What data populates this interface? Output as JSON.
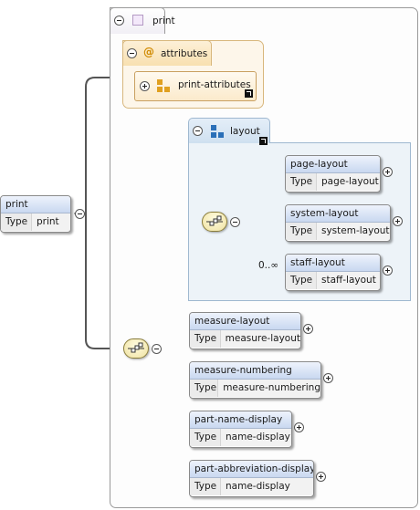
{
  "root": {
    "name": "print",
    "type_key": "Type",
    "type_value": "print"
  },
  "complex_type": {
    "label": "print"
  },
  "attributes": {
    "label": "attributes",
    "group_ref": "print-attributes"
  },
  "layout_group": {
    "label": "layout",
    "elements": [
      {
        "name": "page-layout",
        "type_key": "Type",
        "type_value": "page-layout"
      },
      {
        "name": "system-layout",
        "type_key": "Type",
        "type_value": "system-layout"
      },
      {
        "name": "staff-layout",
        "type_key": "Type",
        "type_value": "staff-layout",
        "multiplicity": "0..∞"
      }
    ]
  },
  "sequence_elements": [
    {
      "name": "measure-layout",
      "type_key": "Type",
      "type_value": "measure-layout"
    },
    {
      "name": "measure-numbering",
      "type_key": "Type",
      "type_value": "measure-numbering"
    },
    {
      "name": "part-name-display",
      "type_key": "Type",
      "type_value": "name-display"
    },
    {
      "name": "part-abbreviation-display",
      "type_key": "Type",
      "type_value": "name-display"
    }
  ],
  "colors": {
    "element_header": "#c9d8f0",
    "attributes": "#f8e0b0",
    "group": "#cfe0f0",
    "complex_type": "#f3e8fa"
  }
}
